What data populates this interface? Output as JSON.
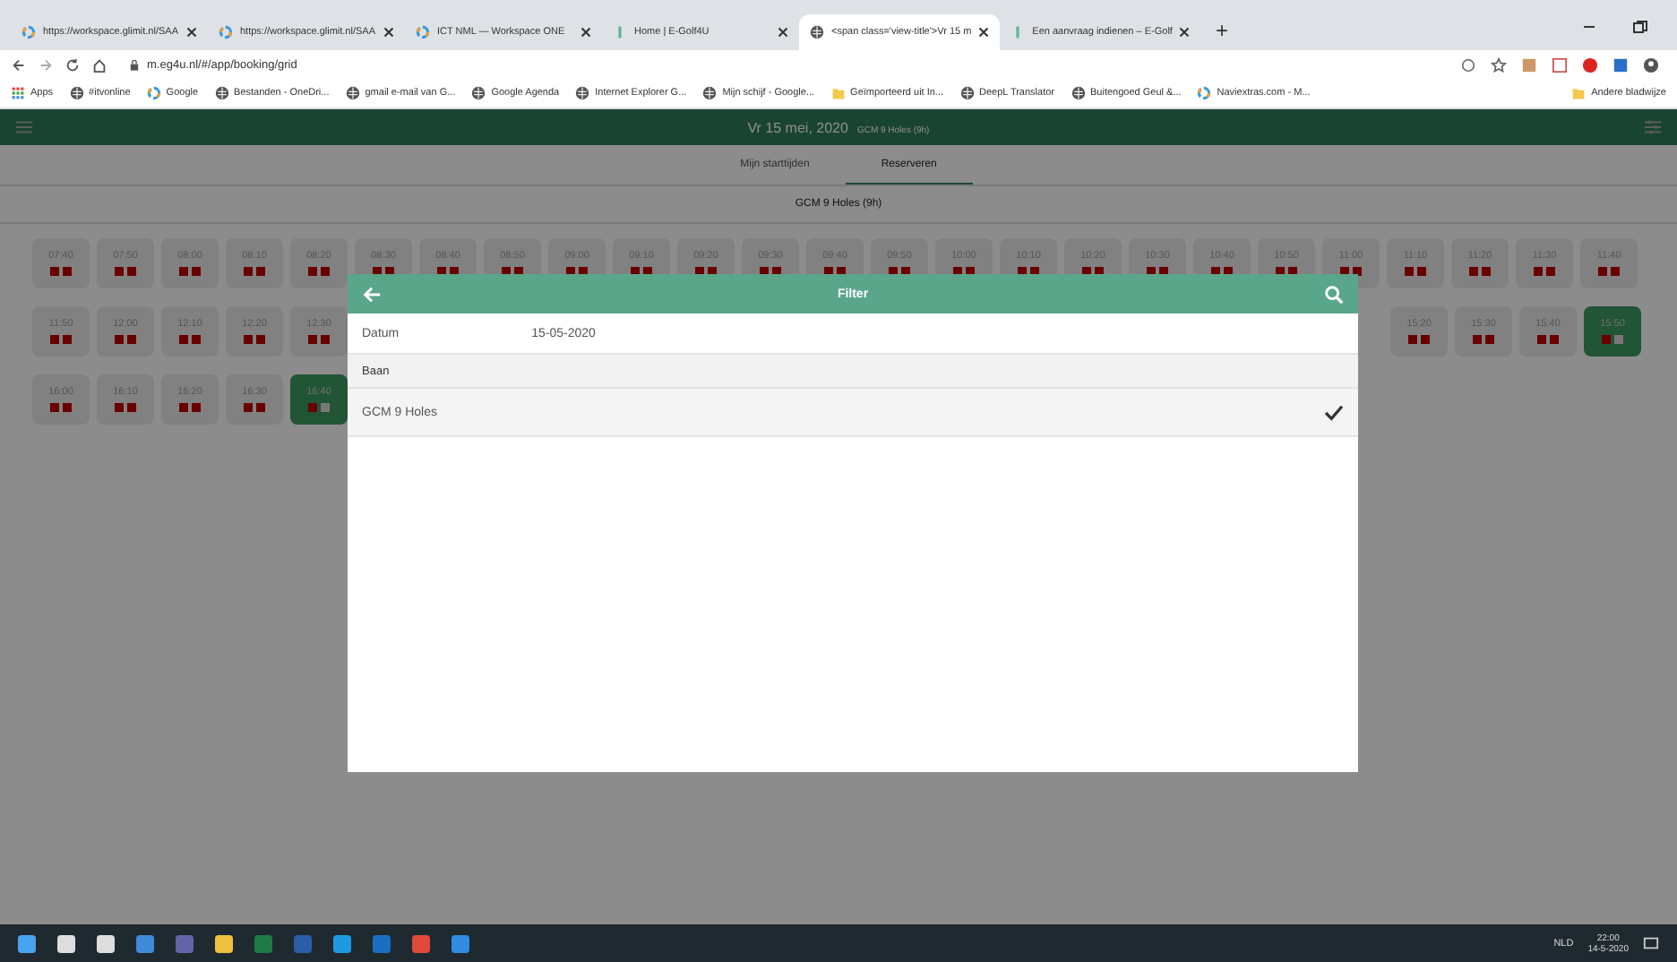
{
  "browser": {
    "tabs": [
      {
        "title": "https://workspace.glimit.nl/SAA",
        "selected": false
      },
      {
        "title": "https://workspace.glimit.nl/SAA",
        "selected": false
      },
      {
        "title": "ICT NML — Workspace ONE",
        "selected": false
      },
      {
        "title": "Home | E-Golf4U",
        "selected": false
      },
      {
        "title": "<span class='view-title'>Vr 15 m",
        "selected": true
      },
      {
        "title": "Een aanvraag indienen – E-Golf",
        "selected": false
      }
    ],
    "new_tab": "+",
    "address": "m.eg4u.nl/#/app/booking/grid",
    "bookmarks": [
      "Apps",
      "#itvonline",
      "Google",
      "Bestanden - OneDri...",
      "gmail e-mail van G...",
      "Google Agenda",
      "Internet Explorer G...",
      "Mijn schijf - Google...",
      "Geïmporteerd uit In...",
      "DeepL Translator",
      "Buitengoed Geul &...",
      "Naviextras.com - M..."
    ],
    "other_bookmarks": "Andere bladwijze"
  },
  "app": {
    "title": "Vr 15 mei, 2020",
    "subtitle": "GCM 9 Holes (9h)",
    "tabs": [
      {
        "label": "Mijn starttijden",
        "selected": false
      },
      {
        "label": "Reserveren",
        "selected": true
      }
    ],
    "course": "GCM 9 Holes (9h)",
    "grid": [
      {
        "left": [
          {
            "time": "07:40",
            "selected": false,
            "spots": [
              {
                "taken": true
              },
              {
                "taken": true
              }
            ]
          },
          {
            "time": "07:50",
            "selected": false,
            "spots": [
              {
                "taken": true
              },
              {
                "taken": true
              }
            ]
          },
          {
            "time": "08:00",
            "selected": false,
            "spots": [
              {
                "taken": true
              },
              {
                "taken": true
              }
            ]
          },
          {
            "time": "08:10",
            "selected": false,
            "spots": [
              {
                "taken": true
              },
              {
                "taken": true
              }
            ]
          },
          {
            "time": "08:20",
            "selected": false,
            "spots": [
              {
                "taken": true
              },
              {
                "taken": true
              }
            ]
          },
          {
            "time": "08:30",
            "selected": false,
            "spots": [
              {
                "taken": true
              },
              {
                "taken": true
              }
            ]
          },
          {
            "time": "08:40",
            "selected": false,
            "spots": [
              {
                "taken": true
              },
              {
                "taken": true
              }
            ]
          },
          {
            "time": "08:50",
            "selected": false,
            "spots": [
              {
                "taken": true
              },
              {
                "taken": true
              }
            ]
          },
          {
            "time": "09:00",
            "selected": false,
            "spots": [
              {
                "taken": true
              },
              {
                "taken": true
              }
            ]
          },
          {
            "time": "09:10",
            "selected": false,
            "spots": [
              {
                "taken": true
              },
              {
                "taken": true
              }
            ]
          },
          {
            "time": "09:20",
            "selected": false,
            "spots": [
              {
                "taken": true
              },
              {
                "taken": true
              }
            ]
          },
          {
            "time": "09:30",
            "selected": false,
            "spots": [
              {
                "taken": true
              },
              {
                "taken": true
              }
            ]
          },
          {
            "time": "09:40",
            "selected": false,
            "spots": [
              {
                "taken": true
              },
              {
                "taken": true
              }
            ]
          },
          {
            "time": "09:50",
            "selected": false,
            "spots": [
              {
                "taken": true
              },
              {
                "taken": true
              }
            ]
          },
          {
            "time": "10:00",
            "selected": false,
            "spots": [
              {
                "taken": true
              },
              {
                "taken": true
              }
            ]
          },
          {
            "time": "10:10",
            "selected": false,
            "spots": [
              {
                "taken": true
              },
              {
                "taken": true
              }
            ]
          },
          {
            "time": "10:20",
            "selected": false,
            "spots": [
              {
                "taken": true
              },
              {
                "taken": true
              }
            ]
          },
          {
            "time": "10:30",
            "selected": false,
            "spots": [
              {
                "taken": true
              },
              {
                "taken": true
              }
            ]
          },
          {
            "time": "10:40",
            "selected": false,
            "spots": [
              {
                "taken": true
              },
              {
                "taken": true
              }
            ]
          },
          {
            "time": "10:50",
            "selected": false,
            "spots": [
              {
                "taken": true
              },
              {
                "taken": true
              }
            ]
          },
          {
            "time": "11:00",
            "selected": false,
            "spots": [
              {
                "taken": true
              },
              {
                "taken": true
              }
            ]
          },
          {
            "time": "11:10",
            "selected": false,
            "spots": [
              {
                "taken": true
              },
              {
                "taken": true
              }
            ]
          },
          {
            "time": "11:20",
            "selected": false,
            "spots": [
              {
                "taken": true
              },
              {
                "taken": true
              }
            ]
          },
          {
            "time": "11:30",
            "selected": false,
            "spots": [
              {
                "taken": true
              },
              {
                "taken": true
              }
            ]
          },
          {
            "time": "11:40",
            "selected": false,
            "spots": [
              {
                "taken": true
              },
              {
                "taken": true
              }
            ]
          }
        ]
      },
      {
        "left": [
          {
            "time": "11:50",
            "selected": false,
            "spots": [
              {
                "taken": true
              },
              {
                "taken": true
              }
            ]
          },
          {
            "time": "12:00",
            "selected": false,
            "spots": [
              {
                "taken": true
              },
              {
                "taken": true
              }
            ]
          },
          {
            "time": "12:10",
            "selected": false,
            "spots": [
              {
                "taken": true
              },
              {
                "taken": true
              }
            ]
          },
          {
            "time": "12:20",
            "selected": false,
            "spots": [
              {
                "taken": true
              },
              {
                "taken": true
              }
            ]
          },
          {
            "time": "12:30",
            "selected": false,
            "spots": [
              {
                "taken": true
              },
              {
                "taken": true
              }
            ]
          }
        ],
        "right": [
          {
            "time": "15:20",
            "selected": false,
            "spots": [
              {
                "taken": true
              },
              {
                "taken": true
              }
            ]
          },
          {
            "time": "15:30",
            "selected": false,
            "spots": [
              {
                "taken": true
              },
              {
                "taken": true
              }
            ]
          },
          {
            "time": "15:40",
            "selected": false,
            "spots": [
              {
                "taken": true
              },
              {
                "taken": true
              }
            ]
          },
          {
            "time": "15:50",
            "selected": true,
            "spots": [
              {
                "taken": true
              },
              {
                "taken": false
              }
            ]
          }
        ]
      },
      {
        "left": [
          {
            "time": "16:00",
            "selected": false,
            "spots": [
              {
                "taken": true
              },
              {
                "taken": true
              }
            ]
          },
          {
            "time": "16:10",
            "selected": false,
            "spots": [
              {
                "taken": true
              },
              {
                "taken": true
              }
            ]
          },
          {
            "time": "16:20",
            "selected": false,
            "spots": [
              {
                "taken": true
              },
              {
                "taken": true
              }
            ]
          },
          {
            "time": "16:30",
            "selected": false,
            "spots": [
              {
                "taken": true
              },
              {
                "taken": true
              }
            ]
          },
          {
            "time": "16:40",
            "selected": true,
            "spots": [
              {
                "taken": true
              },
              {
                "taken": false
              }
            ]
          }
        ]
      }
    ]
  },
  "filter": {
    "title": "Filter",
    "date_label": "Datum",
    "date_value": "15-05-2020",
    "section": "Baan",
    "courses": [
      {
        "label": "GCM 9 Holes",
        "checked": true
      }
    ]
  },
  "taskbar": {
    "language": "NLD",
    "time": "22:00",
    "date": "14-5-2020"
  }
}
